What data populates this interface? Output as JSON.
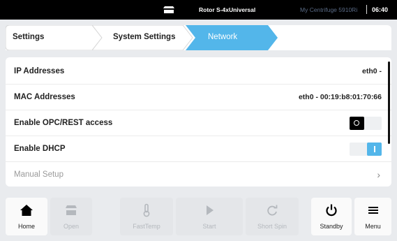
{
  "status_bar": {
    "rotor": "Rotor S-4xUniversal",
    "device_name": "My Centrifuge 5910Ri",
    "time": "06:40"
  },
  "breadcrumb": [
    {
      "label": "Settings"
    },
    {
      "label": "System Settings"
    },
    {
      "label": "Network",
      "active": true
    }
  ],
  "rows": [
    {
      "label": "IP Addresses",
      "value": "eth0 -"
    },
    {
      "label": "MAC Addresses",
      "value": "eth0 - 00:19:b8:01:70:66"
    },
    {
      "label": "Enable OPC/REST access",
      "toggle": "off"
    },
    {
      "label": "Enable DHCP",
      "toggle": "on"
    },
    {
      "label": "Manual Setup",
      "disabled": true
    }
  ],
  "bottom_nav": [
    {
      "label": "Home",
      "icon": "home-icon",
      "enabled": true
    },
    {
      "label": "Open",
      "icon": "open-lid-icon",
      "enabled": false
    },
    {
      "label": "FastTemp",
      "icon": "thermometer-icon",
      "enabled": false
    },
    {
      "label": "Start",
      "icon": "play-icon",
      "enabled": false
    },
    {
      "label": "Short Spin",
      "icon": "refresh-icon",
      "enabled": false
    },
    {
      "label": "Standby",
      "icon": "power-icon",
      "enabled": true
    },
    {
      "label": "Menu",
      "icon": "hamburger-menu-icon",
      "enabled": true
    }
  ],
  "colors": {
    "accent": "#53b6ea",
    "status_bar": "#000000",
    "background": "#e9ebee",
    "disabled_text": "#b4b8bd"
  }
}
